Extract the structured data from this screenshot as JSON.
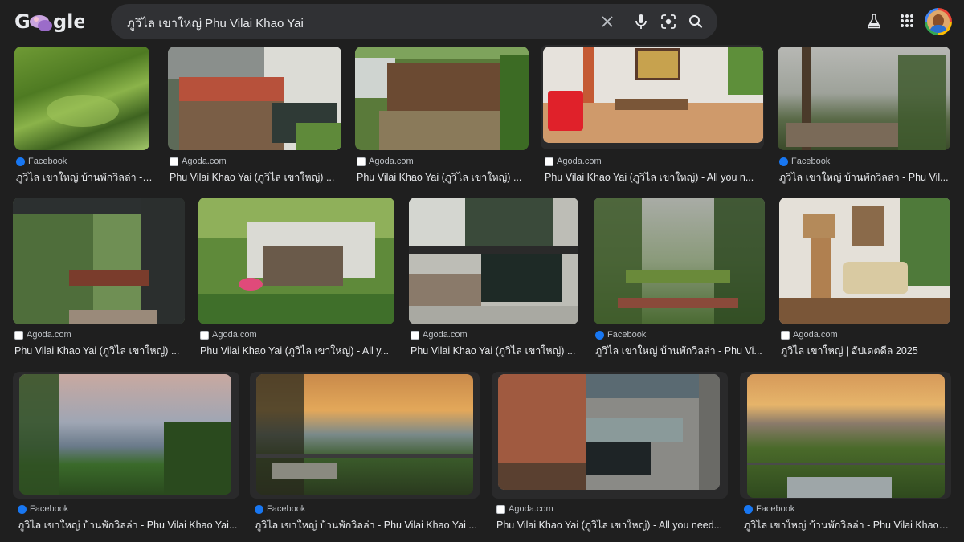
{
  "header": {
    "search_query": "ภูวิไล เขาใหญ่ Phu Vilai Khao Yai"
  },
  "results": [
    {
      "source": "Facebook",
      "title": "ภูวิไล เขาใหญ่ บ้านพักวิลล่า - ..."
    },
    {
      "source": "Agoda.com",
      "title": "Phu Vilai Khao Yai (ภูวิไล เขาใหญ่) ..."
    },
    {
      "source": "Agoda.com",
      "title": "Phu Vilai Khao Yai (ภูวิไล เขาใหญ่) ..."
    },
    {
      "source": "Agoda.com",
      "title": "Phu Vilai Khao Yai (ภูวิไล เขาใหญ่) - All you n..."
    },
    {
      "source": "Facebook",
      "title": "ภูวิไล เขาใหญ่ บ้านพักวิลล่า - Phu Vil..."
    },
    {
      "source": "Agoda.com",
      "title": "Phu Vilai Khao Yai (ภูวิไล เขาใหญ่) ..."
    },
    {
      "source": "Agoda.com",
      "title": "Phu Vilai Khao Yai (ภูวิไล เขาใหญ่) - All y..."
    },
    {
      "source": "Agoda.com",
      "title": "Phu Vilai Khao Yai (ภูวิไล เขาใหญ่) ..."
    },
    {
      "source": "Facebook",
      "title": "ภูวิไล เขาใหญ่ บ้านพักวิลล่า - Phu Vi..."
    },
    {
      "source": "Agoda.com",
      "title": "ภูวิไล เขาใหญ่ | อัปเดตดีล 2025"
    },
    {
      "source": "Facebook",
      "title": "ภูวิไล เขาใหญ่ บ้านพักวิลล่า - Phu Vilai Khao Yai..."
    },
    {
      "source": "Facebook",
      "title": "ภูวิไล เขาใหญ่ บ้านพักวิลล่า - Phu Vilai Khao Yai ..."
    },
    {
      "source": "Agoda.com",
      "title": "Phu Vilai Khao Yai (ภูวิไล เขาใหญ่) - All you need..."
    },
    {
      "source": "Facebook",
      "title": "ภูวิไล เขาใหญ่ บ้านพักวิลล่า - Phu Vilai Khao ..."
    }
  ],
  "icons": {
    "logo": "google-doodle-logo",
    "clear": "close-icon",
    "voice": "microphone-icon",
    "lens": "camera-lens-icon",
    "search": "search-icon",
    "labs": "flask-icon",
    "apps": "apps-grid-icon",
    "account": "avatar"
  },
  "colors": {
    "background": "#1f1f1f",
    "searchbar": "#303134",
    "facebook": "#1877f2",
    "text": "#e8eaed",
    "source_text": "#bdc1c6"
  }
}
